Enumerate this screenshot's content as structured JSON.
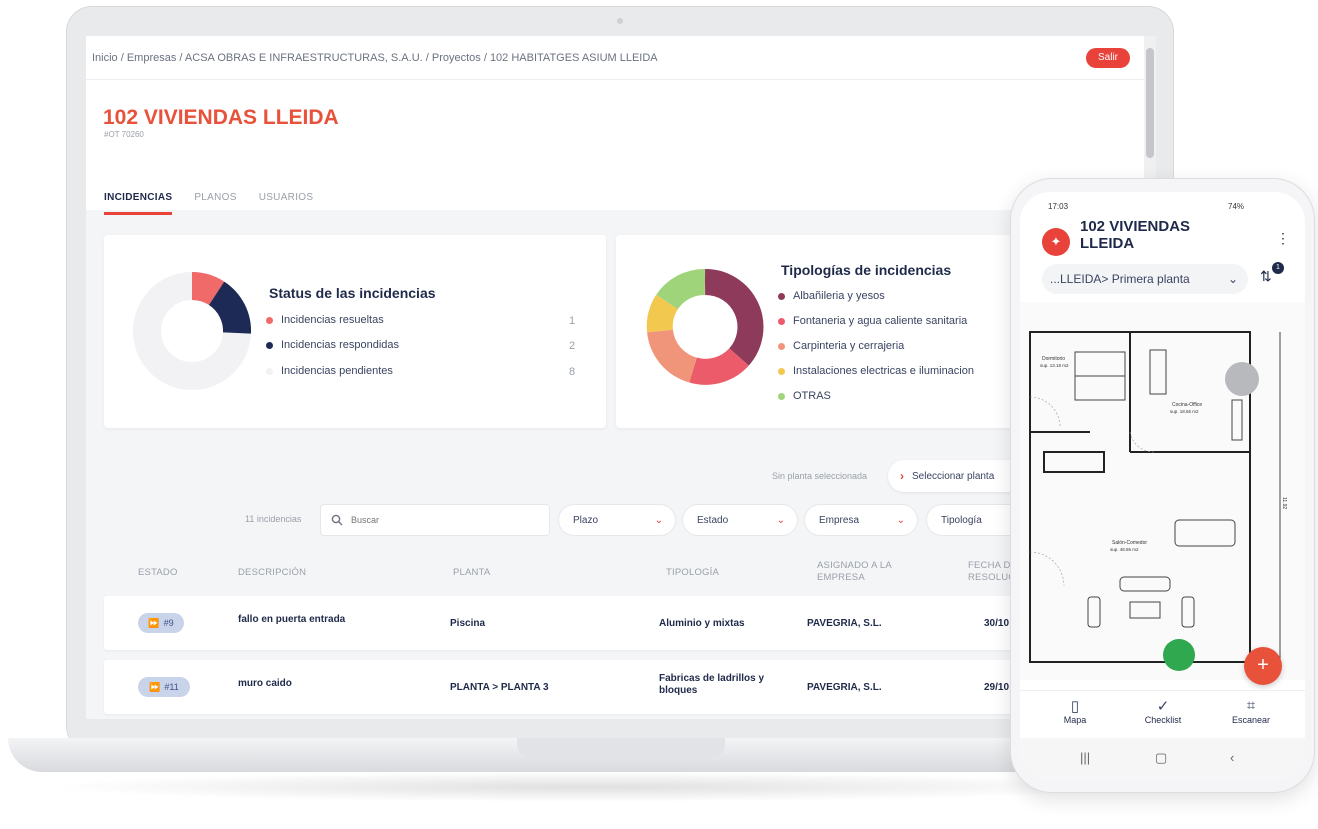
{
  "breadcrumb": "Inicio / Empresas / ACSA OBRAS E INFRAESTRUCTURAS, S.A.U. / Proyectos / 102 HABITATGES ASIUM LLEIDA",
  "logout_label": "Salir",
  "project": {
    "title": "102 VIVIENDAS LLEIDA",
    "subtitle": "#OT 70260"
  },
  "tabs": [
    {
      "label": "INCIDENCIAS",
      "active": true
    },
    {
      "label": "PLANOS",
      "active": false
    },
    {
      "label": "USUARIOS",
      "active": false
    }
  ],
  "status_card": {
    "title": "Status de las incidencias",
    "items": [
      {
        "label": "Incidencias resueltas",
        "count": "1",
        "color": "#f06a6a"
      },
      {
        "label": "Incidencias respondidas",
        "count": "2",
        "color": "#1c2a55"
      },
      {
        "label": "Incidencias pendientes",
        "count": "8",
        "color": "#f2f2f4"
      }
    ]
  },
  "types_card": {
    "title": "Tipologías de incidencias",
    "items": [
      {
        "label": "Albañileria y yesos",
        "color": "#8e3a5a"
      },
      {
        "label": "Fontaneria y agua caliente sanitaria",
        "color": "#ec5b6a"
      },
      {
        "label": "Carpinteria y cerrajeria",
        "color": "#f0957a"
      },
      {
        "label": "Instalaciones electricas e iluminacion",
        "color": "#f3c84e"
      },
      {
        "label": "OTRAS",
        "color": "#9fd47a"
      }
    ]
  },
  "plan_hint": "Sin planta seleccionada",
  "plan_button": "Seleccionar planta",
  "incidents_count": "11 incidencias",
  "search_placeholder": "Buscar",
  "filters": [
    "Plazo",
    "Estado",
    "Empresa",
    "Tipología"
  ],
  "table": {
    "headers": [
      "ESTADO",
      "DESCRIPCIÓN",
      "PLANTA",
      "TIPOLOGÍA",
      "ASIGNADO A LA EMPRESA",
      "FECHA DE RESOLUCIÓN"
    ],
    "rows": [
      {
        "id": "#9",
        "description": "fallo en puerta entrada",
        "plant": "Piscina",
        "type": "Aluminio y mixtas",
        "company": "PAVEGRIA, S.L.",
        "date": "30/10"
      },
      {
        "id": "#11",
        "description": "muro caido",
        "plant": "PLANTA > PLANTA 3",
        "type": "Fabricas de ladrillos y bloques",
        "company": "PAVEGRIA, S.L.",
        "date": "29/10"
      }
    ]
  },
  "mobile": {
    "status_time": "17:03",
    "status_battery": "74%",
    "title": "102 VIVIENDAS LLEIDA",
    "plan_select": "...LLEIDA> Primera planta",
    "filter_badge": "1",
    "rooms": {
      "dormitorio": "Dormitorio",
      "dormitorio_area": "sup. 13.18 m2",
      "cocina": "Cocina-Office",
      "cocina_area": "sup. 18.65 m2",
      "salon": "Salón-Comedor",
      "salon_area": "sup. 48.55 m2",
      "dimension": "11.92"
    },
    "nav": [
      "Mapa",
      "Checklist",
      "Escanear"
    ]
  }
}
